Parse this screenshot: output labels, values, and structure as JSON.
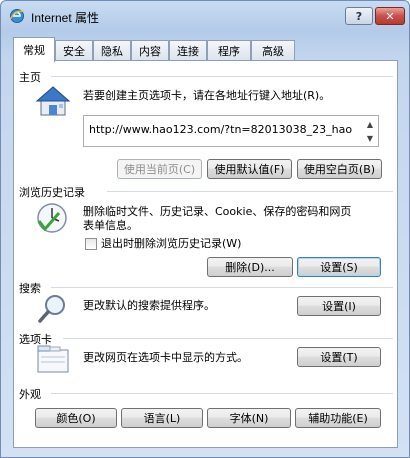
{
  "window": {
    "title": "Internet 属性",
    "help_label": "?",
    "close_label": "✕"
  },
  "tabs": [
    {
      "label": "常规",
      "active": true
    },
    {
      "label": "安全"
    },
    {
      "label": "隐私"
    },
    {
      "label": "内容"
    },
    {
      "label": "连接"
    },
    {
      "label": "程序"
    },
    {
      "label": "高级"
    }
  ],
  "home": {
    "title": "主页",
    "description": "若要创建主页选项卡，请在各地址行键入地址(R)。",
    "url": "http://www.hao123.com/?tn=82013038_23_hao",
    "use_current": "使用当前页(C)",
    "use_default": "使用默认值(F)",
    "use_blank": "使用空白页(B)"
  },
  "history": {
    "title": "浏览历史记录",
    "description_line1": "删除临时文件、历史记录、Cookie、保存的密码和网页",
    "description_line2": "表单信息。",
    "checkbox_label": "退出时删除浏览历史记录(W)",
    "delete_button": "删除(D)...",
    "settings_button": "设置(S)"
  },
  "search": {
    "title": "搜索",
    "description": "更改默认的搜索提供程序。",
    "settings_button": "设置(I)"
  },
  "tabs_section": {
    "title": "选项卡",
    "description": "更改网页在选项卡中显示的方式。",
    "settings_button": "设置(T)"
  },
  "appearance": {
    "title": "外观",
    "colors_button": "颜色(O)",
    "languages_button": "语言(L)",
    "fonts_button": "字体(N)",
    "accessibility_button": "辅助功能(E)"
  }
}
